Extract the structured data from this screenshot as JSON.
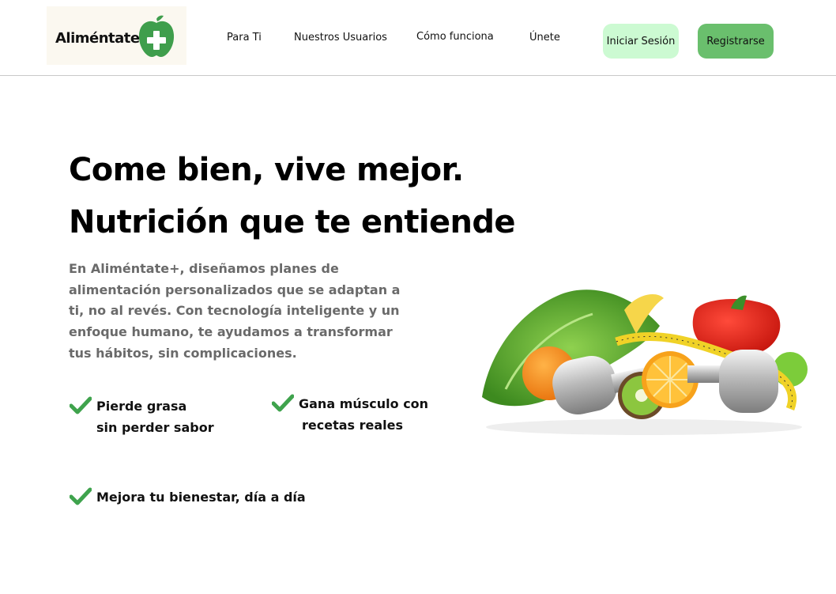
{
  "brand": {
    "name": "Aliméntate",
    "accent_green": "#3f9e4c",
    "plus_symbol": "+"
  },
  "nav": {
    "items": [
      "Para Ti",
      "Nuestros Usuarios",
      "Cómo funciona",
      "Únete"
    ]
  },
  "actions": {
    "login_label": "Iniciar Sesión",
    "register_label": "Registrarse",
    "login_color": "#ccfad2",
    "register_color": "#6abf6d"
  },
  "hero": {
    "title_line1": "Come bien, vive mejor.",
    "title_line2": "Nutrición que te entiende",
    "description": "En Aliméntate+, diseñamos planes de alimentación personalizados que se adaptan a ti, no al revés. Con tecnología inteligente y un enfoque humano, te ayudamos a transformar tus hábitos, sin complicaciones.",
    "image_icon": "fruits-vegetables-dumbbells-image"
  },
  "features": [
    {
      "line1": "Pierde grasa",
      "line2": "sin perder sabor",
      "icon": "check-icon"
    },
    {
      "line1": "Gana músculo con",
      "line2": "recetas reales",
      "icon": "check-icon"
    },
    {
      "line1": "Mejora tu bienestar, día a día",
      "line2": "",
      "icon": "check-icon"
    }
  ]
}
